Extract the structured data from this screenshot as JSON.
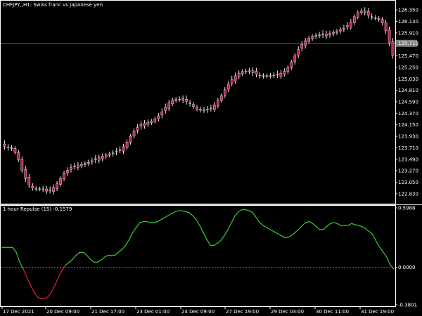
{
  "window": {
    "symbol_title": "CHFJPY,,H1:  Swiss franc vs Japanese yen"
  },
  "indicator": {
    "title": "1 hour Repulse (15) -0.1579"
  },
  "colors": {
    "background": "#000000",
    "frame": "#ffffff",
    "candle_body": "#c2185b",
    "candle_wick": "#ffffff",
    "repulse_positive": "#33cc33",
    "repulse_negative": "#e01e3c",
    "zero_line": "#808080",
    "current_price_line": "#808080",
    "price_tag_bg": "#808080"
  },
  "chart_data": [
    {
      "type": "candlestick",
      "x_ticks": [
        "17 Dec 2021",
        "20 Dec 09:00",
        "21 Dec 17:00",
        "23 Dec 01:00",
        "24 Dec 09:00",
        "27 Dec 19:00",
        "29 Dec 03:00",
        "30 Dec 11:00",
        "31 Dec 19:00"
      ],
      "ylim": [
        122.72,
        126.46
      ],
      "y_ticks": [
        "126.350",
        "126.130",
        "125.910",
        "125.690",
        "125.470",
        "125.250",
        "125.030",
        "124.810",
        "124.590",
        "124.370",
        "124.150",
        "123.930",
        "123.710",
        "123.490",
        "123.270",
        "123.050",
        "122.830"
      ],
      "current_price": "125.710",
      "close": [
        123.74,
        123.72,
        123.71,
        123.62,
        123.48,
        123.28,
        123.12,
        123.0,
        122.94,
        122.93,
        122.92,
        122.91,
        122.88,
        122.9,
        122.95,
        123.02,
        123.12,
        123.22,
        123.28,
        123.33,
        123.36,
        123.38,
        123.39,
        123.41,
        123.43,
        123.46,
        123.5,
        123.52,
        123.55,
        123.57,
        123.59,
        123.61,
        123.64,
        123.67,
        123.73,
        123.82,
        123.93,
        124.03,
        124.1,
        124.16,
        124.18,
        124.2,
        124.22,
        124.26,
        124.32,
        124.4,
        124.49,
        124.57,
        124.62,
        124.64,
        124.64,
        124.62,
        124.6,
        124.56,
        124.5,
        124.45,
        124.43,
        124.43,
        124.44,
        124.47,
        124.53,
        124.62,
        124.71,
        124.82,
        124.93,
        125.02,
        125.09,
        125.14,
        125.17,
        125.18,
        125.17,
        125.15,
        125.12,
        125.1,
        125.09,
        125.09,
        125.09,
        125.1,
        125.11,
        125.14,
        125.18,
        125.25,
        125.35,
        125.47,
        125.59,
        125.69,
        125.76,
        125.81,
        125.84,
        125.86,
        125.87,
        125.88,
        125.89,
        125.9,
        125.92,
        125.94,
        125.97,
        126.0,
        126.05,
        126.12,
        126.22,
        126.3,
        126.33,
        126.3,
        126.25,
        126.22,
        126.2,
        126.17,
        126.1,
        125.95,
        125.72,
        125.48
      ]
    },
    {
      "type": "line",
      "name": "Repulse (15)",
      "ylim": [
        -0.3801,
        0.5988
      ],
      "y_ticks": [
        "0.5988",
        "0.0000",
        "-0.3801"
      ],
      "values": [
        0.2,
        0.2,
        0.2,
        0.2,
        0.15,
        0.05,
        -0.02,
        -0.1,
        -0.18,
        -0.25,
        -0.3,
        -0.32,
        -0.32,
        -0.3,
        -0.25,
        -0.18,
        -0.1,
        -0.03,
        0.02,
        0.05,
        0.08,
        0.12,
        0.15,
        0.15,
        0.12,
        0.08,
        0.05,
        0.05,
        0.07,
        0.1,
        0.12,
        0.12,
        0.12,
        0.15,
        0.18,
        0.22,
        0.28,
        0.35,
        0.4,
        0.45,
        0.46,
        0.46,
        0.45,
        0.45,
        0.46,
        0.48,
        0.5,
        0.52,
        0.54,
        0.56,
        0.57,
        0.57,
        0.56,
        0.55,
        0.52,
        0.48,
        0.42,
        0.35,
        0.28,
        0.22,
        0.22,
        0.24,
        0.27,
        0.32,
        0.38,
        0.45,
        0.52,
        0.56,
        0.58,
        0.58,
        0.57,
        0.55,
        0.5,
        0.45,
        0.42,
        0.4,
        0.38,
        0.36,
        0.34,
        0.32,
        0.3,
        0.3,
        0.32,
        0.35,
        0.38,
        0.42,
        0.45,
        0.46,
        0.44,
        0.41,
        0.38,
        0.38,
        0.41,
        0.44,
        0.45,
        0.44,
        0.42,
        0.42,
        0.42,
        0.44,
        0.43,
        0.42,
        0.41,
        0.39,
        0.36,
        0.33,
        0.26,
        0.2,
        0.15,
        0.1,
        0.02,
        -0.02
      ]
    }
  ]
}
